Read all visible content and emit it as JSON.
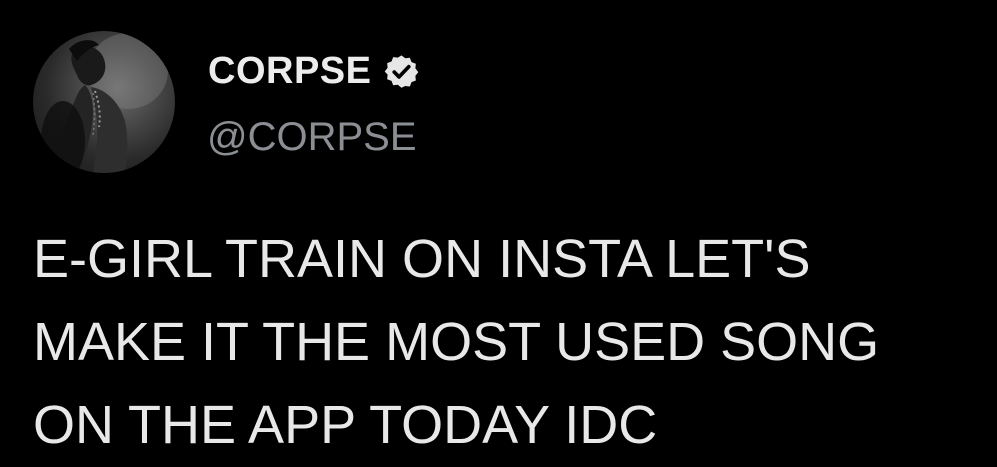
{
  "author": {
    "display_name": "CORPSE",
    "handle": "@CORPSE",
    "verified": true,
    "avatar_icon": "profile-photo-avatar"
  },
  "tweet": {
    "text": "E-GIRL TRAIN ON INSTA LET'S\nMAKE IT THE MOST USED SONG\nON THE APP TODAY IDC"
  },
  "colors": {
    "background": "#000000",
    "name": "#ececec",
    "handle": "#8b8f94",
    "text": "#e8e8e8",
    "verified_badge": "#e6e6e6"
  }
}
